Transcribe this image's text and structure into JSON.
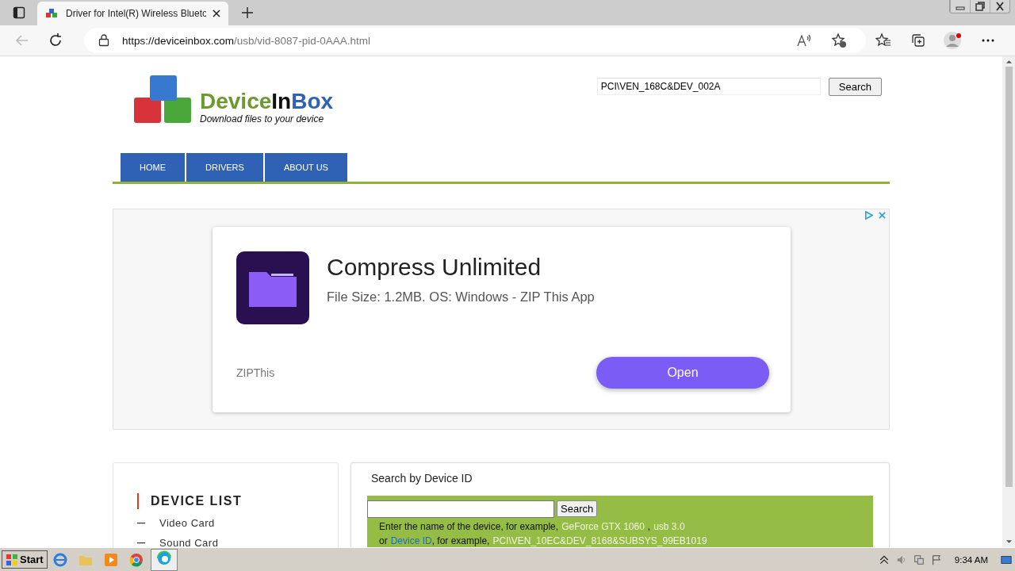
{
  "browser": {
    "tab_title": "Driver for Intel(R) Wireless Blueto",
    "url_domain": "https://deviceinbox.com",
    "url_path": "/usb/vid-8087-pid-0AAA.html"
  },
  "site": {
    "logo_first": "Device",
    "logo_mid": "In",
    "logo_last": "Box",
    "tagline": "Download files to your device",
    "search_value": "PCI\\VEN_168C&DEV_002A",
    "search_button": "Search",
    "nav": [
      {
        "label": "HOME"
      },
      {
        "label": "DRIVERS"
      },
      {
        "label": "ABOUT US"
      }
    ]
  },
  "ad": {
    "title": "Compress Unlimited",
    "description": "File Size: 1.2MB. OS: Windows - ZIP This App",
    "advertiser": "ZIPThis",
    "button": "Open"
  },
  "device_list": {
    "heading": "DEVICE LIST",
    "items": [
      "Video Card",
      "Sound Card"
    ]
  },
  "search_panel": {
    "title": "Search by Device ID",
    "button": "Search",
    "line1_text": "Enter the name of the device, for example,",
    "line1_examples": [
      "GeForce GTX 1060",
      "usb 3.0"
    ],
    "line1_separator": ",",
    "line2_prefix": "or",
    "line2_link": "Device ID",
    "line2_text": ", for example,",
    "line2_example": "PCI\\VEN_10EC&DEV_8168&SUBSYS_99EB1019"
  },
  "taskbar": {
    "start": "Start",
    "clock": "9:34 AM"
  }
}
